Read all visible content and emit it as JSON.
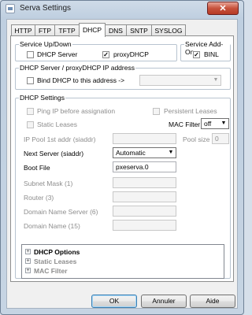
{
  "window": {
    "title": "Serva Settings",
    "close_glyph": "✕"
  },
  "tabs": [
    {
      "label": "HTTP",
      "active": false
    },
    {
      "label": "FTP",
      "active": false
    },
    {
      "label": "TFTP",
      "active": false
    },
    {
      "label": "DHCP",
      "active": true
    },
    {
      "label": "DNS",
      "active": false
    },
    {
      "label": "SNTP",
      "active": false
    },
    {
      "label": "SYSLOG",
      "active": false
    }
  ],
  "service_updown": {
    "title": "Service Up/Down",
    "dhcp_server": {
      "label": "DHCP Server",
      "checked": false
    },
    "proxy_dhcp": {
      "label": "proxyDHCP",
      "checked": true
    }
  },
  "service_addon": {
    "title": "Service Add-On",
    "binl": {
      "label": "BINL",
      "checked": true
    }
  },
  "bind": {
    "title": "DHCP Server / proxyDHCP IP address",
    "label": "Bind DHCP to this address  ->",
    "checked": false,
    "address": ""
  },
  "settings": {
    "title": "DHCP Settings",
    "ping_ip": {
      "label": "Ping IP before assignation",
      "checked": false
    },
    "persistent_leases": {
      "label": "Persistent Leases",
      "checked": false
    },
    "static_leases": {
      "label": "Static Leases",
      "checked": false
    },
    "mac_filter_label": "MAC Filter",
    "mac_filter_value": "off",
    "ip_pool_label": "IP Pool 1st addr (siaddr)",
    "ip_pool_value": "",
    "pool_size_label": "Pool size",
    "pool_size_value": "0",
    "next_server_label": "Next Server (siaddr)",
    "next_server_value": "Automatic",
    "boot_file_label": "Boot File",
    "boot_file_value": "pxeserva.0",
    "subnet_mask_label": "Subnet Mask  (1)",
    "subnet_mask_value": "",
    "router_label": "Router  (3)",
    "router_value": "",
    "dns_label": "Domain Name Server  (6)",
    "dns_value": "",
    "domain_name_label": "Domain Name  (15)",
    "domain_name_value": ""
  },
  "tree": [
    {
      "label": "DHCP Options",
      "enabled": true
    },
    {
      "label": "Static Leases",
      "enabled": false
    },
    {
      "label": "MAC Filter",
      "enabled": false
    }
  ],
  "buttons": {
    "ok": "OK",
    "cancel": "Annuler",
    "help": "Aide"
  },
  "glyphs": {
    "check": "✓",
    "dropdown": "▼",
    "expand": "+"
  },
  "colors": {
    "accent": "#3c7fb1",
    "close": "#c7523c"
  }
}
